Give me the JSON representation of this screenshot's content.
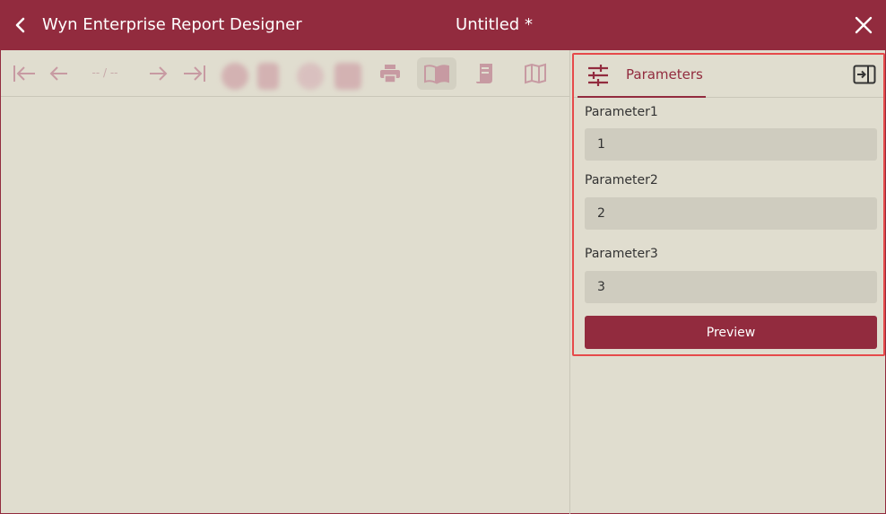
{
  "titlebar": {
    "app_title": "Wyn Enterprise Report Designer",
    "document_title": "Untitled *",
    "icons": {
      "back": "chevron-left-icon",
      "close": "close-icon"
    }
  },
  "toolbar": {
    "page_indicator": "-- / --",
    "icons": [
      "first-page-icon",
      "previous-page-icon",
      "next-page-icon",
      "last-page-icon",
      "print-icon",
      "book-icon",
      "scroll-icon",
      "map-icon"
    ]
  },
  "parameters_panel": {
    "tab_label": "Parameters",
    "tab_icon": "sliders-icon",
    "collapse_icon": "collapse-panel-icon",
    "fields": [
      {
        "label": "Parameter1",
        "value": "1"
      },
      {
        "label": "Parameter2",
        "value": "2"
      },
      {
        "label": "Parameter3",
        "value": "3"
      }
    ],
    "preview_label": "Preview"
  },
  "colors": {
    "brand": "#922b3e",
    "background": "#e0ddcf",
    "input_bg": "#cfccbf",
    "highlight_border": "#e64a4a",
    "disabled_icon": "#c7a9a9"
  }
}
